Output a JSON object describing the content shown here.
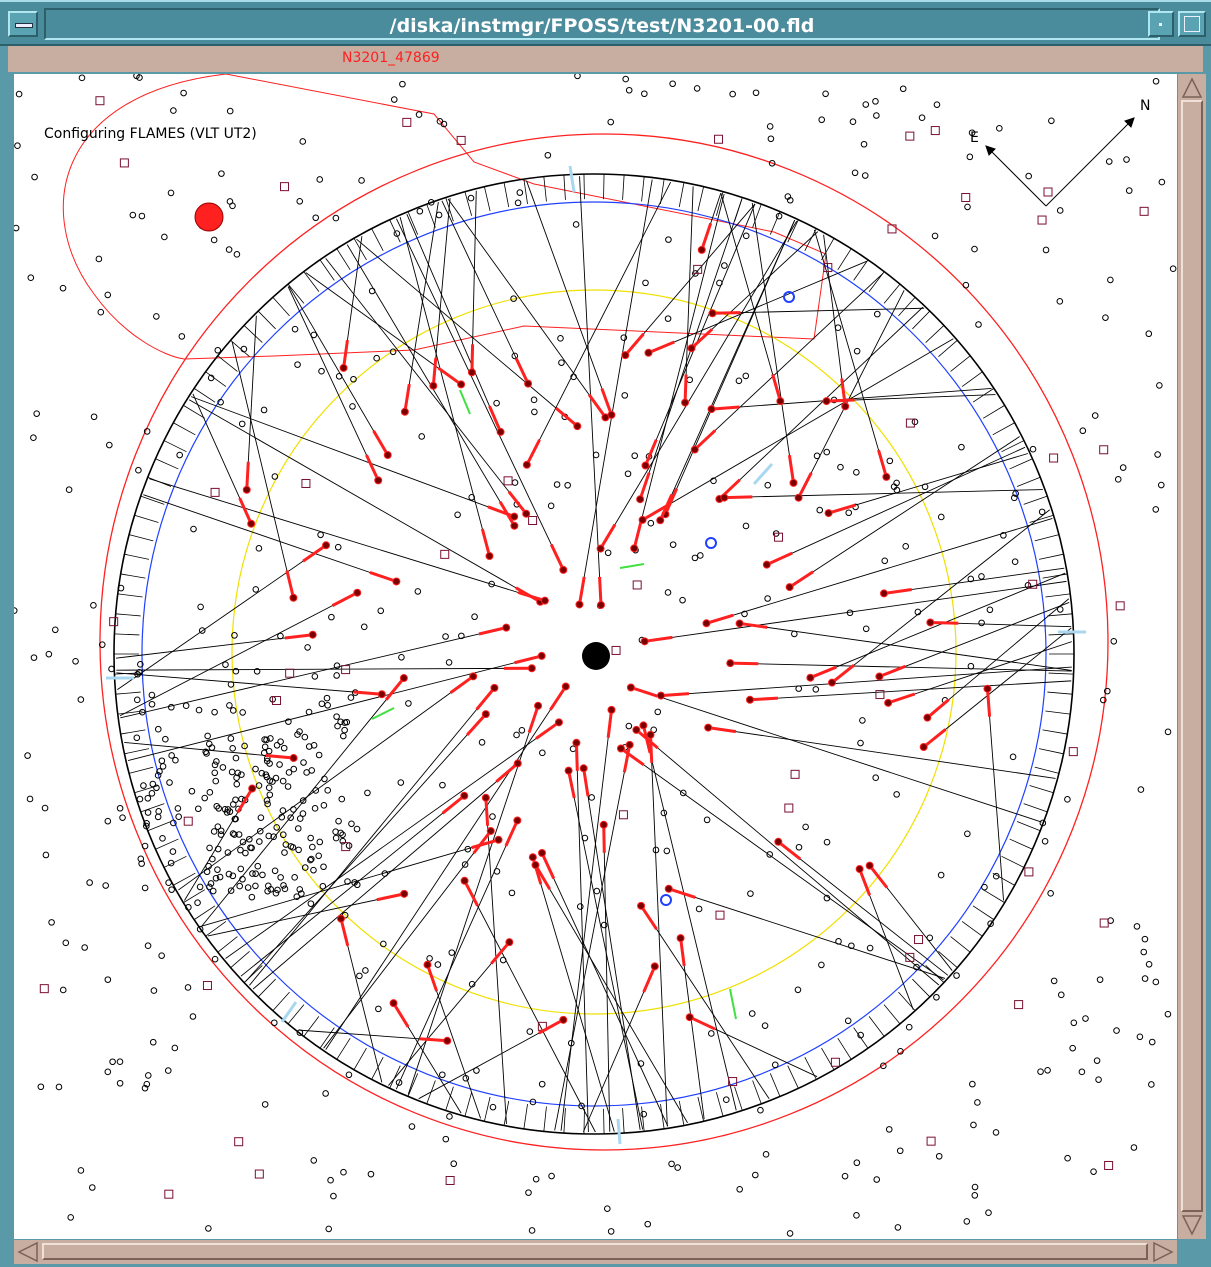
{
  "window": {
    "title": "/diska/instmgr/FPOSS/test/N3201-00.fld",
    "field_name": "N3201_47869"
  },
  "canvas": {
    "status_text": "Configuring FLAMES (VLT UT2)",
    "compass": {
      "north_label": "N",
      "east_label": "E"
    }
  },
  "colors": {
    "boundary": "#ff2020",
    "inner_circle": "#2040ff",
    "yellow_circle": "#f0e000",
    "fiber_line": "#000000",
    "button": "#ff2020",
    "guide_square": "#7a1030",
    "guide_fiber": "#40e040",
    "parked_tick": "#a8d8f0"
  },
  "icons": {
    "window_menu": "window-menu-icon",
    "minimize": "minimize-icon",
    "maximize": "maximize-icon",
    "scroll_up": "arrow-up-icon",
    "scroll_down": "arrow-down-icon",
    "scroll_left": "arrow-left-icon",
    "scroll_right": "arrow-right-icon"
  }
}
